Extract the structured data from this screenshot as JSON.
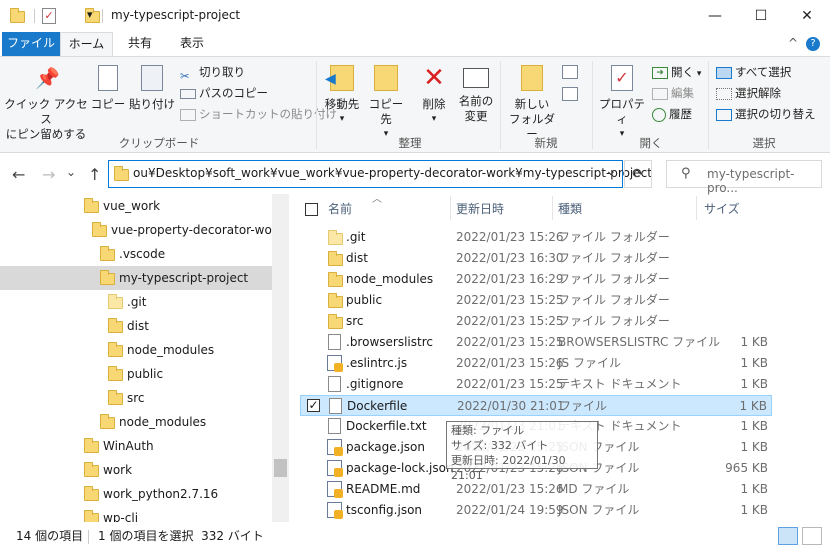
{
  "window": {
    "title": "my-typescript-project",
    "minimize_glyph": "—",
    "maximize_glyph": "☐",
    "close_glyph": "✕",
    "qat_dropdown_glyph": "▾"
  },
  "ribbon_tabs": {
    "file": "ファイル",
    "home": "ホーム",
    "share": "共有",
    "view": "表示",
    "collapse_glyph": "^",
    "help_glyph": "?"
  },
  "ribbon": {
    "clipboard": {
      "pin_quick_access": [
        "クイック アクセス",
        "にピン留めする"
      ],
      "copy": "コピー",
      "paste": "貼り付け",
      "cut": "切り取り",
      "copy_path": "パスのコピー",
      "paste_shortcut": "ショートカットの貼り付け",
      "group": "クリップボード"
    },
    "organize": {
      "move_to": "移動先",
      "copy_to": "コピー先",
      "delete": "削除",
      "rename": [
        "名前の",
        "変更"
      ],
      "group": "整理"
    },
    "new": {
      "new_folder": [
        "新しい",
        "フォルダー"
      ],
      "group": "新規"
    },
    "open": {
      "properties": "プロパティ",
      "open": "開く",
      "edit": "編集",
      "history": "履歴",
      "group": "開く"
    },
    "select": {
      "select_all": "すべて選択",
      "select_none": "選択解除",
      "invert": "選択の切り替え",
      "group": "選択"
    }
  },
  "address_bar": {
    "path": "ou¥Desktop¥soft_work¥vue_work¥vue-property-decorator-work¥my-typescript-project",
    "search_placeholder": "my-typescript-pro...",
    "back": "←",
    "forward": "→",
    "up": "↑",
    "dropdown": "⌄",
    "refresh": "⟳",
    "recent": "⌄"
  },
  "tree": [
    {
      "label": "vue_work",
      "indent": 1,
      "light": false
    },
    {
      "label": "vue-property-decorator-work",
      "indent": 2,
      "light": false
    },
    {
      "label": ".vscode",
      "indent": 3,
      "light": false
    },
    {
      "label": "my-typescript-project",
      "indent": 3,
      "light": false,
      "selected": true
    },
    {
      "label": ".git",
      "indent": 4,
      "light": true
    },
    {
      "label": "dist",
      "indent": 4,
      "light": false
    },
    {
      "label": "node_modules",
      "indent": 4,
      "light": false
    },
    {
      "label": "public",
      "indent": 4,
      "light": false
    },
    {
      "label": "src",
      "indent": 4,
      "light": false
    },
    {
      "label": "node_modules",
      "indent": 3,
      "light": false
    },
    {
      "label": "WinAuth",
      "indent": 1,
      "light": false
    },
    {
      "label": "work",
      "indent": 1,
      "light": false
    },
    {
      "label": "work_python2.7.16",
      "indent": 1,
      "light": false
    },
    {
      "label": "wp-cli",
      "indent": 1,
      "light": false
    }
  ],
  "columns": {
    "name": "名前",
    "date": "更新日時",
    "type": "種類",
    "size": "サイズ"
  },
  "files": [
    {
      "name": ".git",
      "date": "2022/01/23 15:26",
      "type": "ファイル フォルダー",
      "size": "",
      "icon": "folder-light"
    },
    {
      "name": "dist",
      "date": "2022/01/23 16:30",
      "type": "ファイル フォルダー",
      "size": "",
      "icon": "folder"
    },
    {
      "name": "node_modules",
      "date": "2022/01/23 16:29",
      "type": "ファイル フォルダー",
      "size": "",
      "icon": "folder"
    },
    {
      "name": "public",
      "date": "2022/01/23 15:25",
      "type": "ファイル フォルダー",
      "size": "",
      "icon": "folder"
    },
    {
      "name": "src",
      "date": "2022/01/23 15:25",
      "type": "ファイル フォルダー",
      "size": "",
      "icon": "folder"
    },
    {
      "name": ".browserslistrc",
      "date": "2022/01/23 15:25",
      "type": "BROWSERSLISTRC ファイル",
      "size": "1 KB",
      "icon": "file"
    },
    {
      "name": ".eslintrc.js",
      "date": "2022/01/23 15:26",
      "type": "JS ファイル",
      "size": "1 KB",
      "icon": "script"
    },
    {
      "name": ".gitignore",
      "date": "2022/01/23 15:25",
      "type": "テキスト ドキュメント",
      "size": "1 KB",
      "icon": "file"
    },
    {
      "name": "Dockerfile",
      "date": "2022/01/30 21:01",
      "type": "ファイル",
      "size": "1 KB",
      "icon": "file",
      "selected": true
    },
    {
      "name": "Dockerfile.txt",
      "date": "2022/01/23 21:01",
      "type": "テキスト ドキュメント",
      "size": "1 KB",
      "icon": "file"
    },
    {
      "name": "package.json",
      "date": "2022/01/23 15:25",
      "type": "JSON ファイル",
      "size": "1 KB",
      "icon": "script"
    },
    {
      "name": "package-lock.json",
      "date": "2022/01/23 15:26",
      "type": "JSON ファイル",
      "size": "965 KB",
      "icon": "script"
    },
    {
      "name": "README.md",
      "date": "2022/01/23 15:26",
      "type": "MD ファイル",
      "size": "1 KB",
      "icon": "script"
    },
    {
      "name": "tsconfig.json",
      "date": "2022/01/24 19:59",
      "type": "JSON ファイル",
      "size": "1 KB",
      "icon": "script"
    }
  ],
  "tooltip": {
    "line1": "種類: ファイル",
    "line2": "サイズ: 332 バイト",
    "line3": "更新日時: 2022/01/30 21:01"
  },
  "status": {
    "item_count": "14 個の項目",
    "selection": "1 個の項目を選択  332 バイト"
  },
  "colors": {
    "accent": "#1979ca",
    "selection": "#cce8ff",
    "folder": "#f8d775"
  }
}
